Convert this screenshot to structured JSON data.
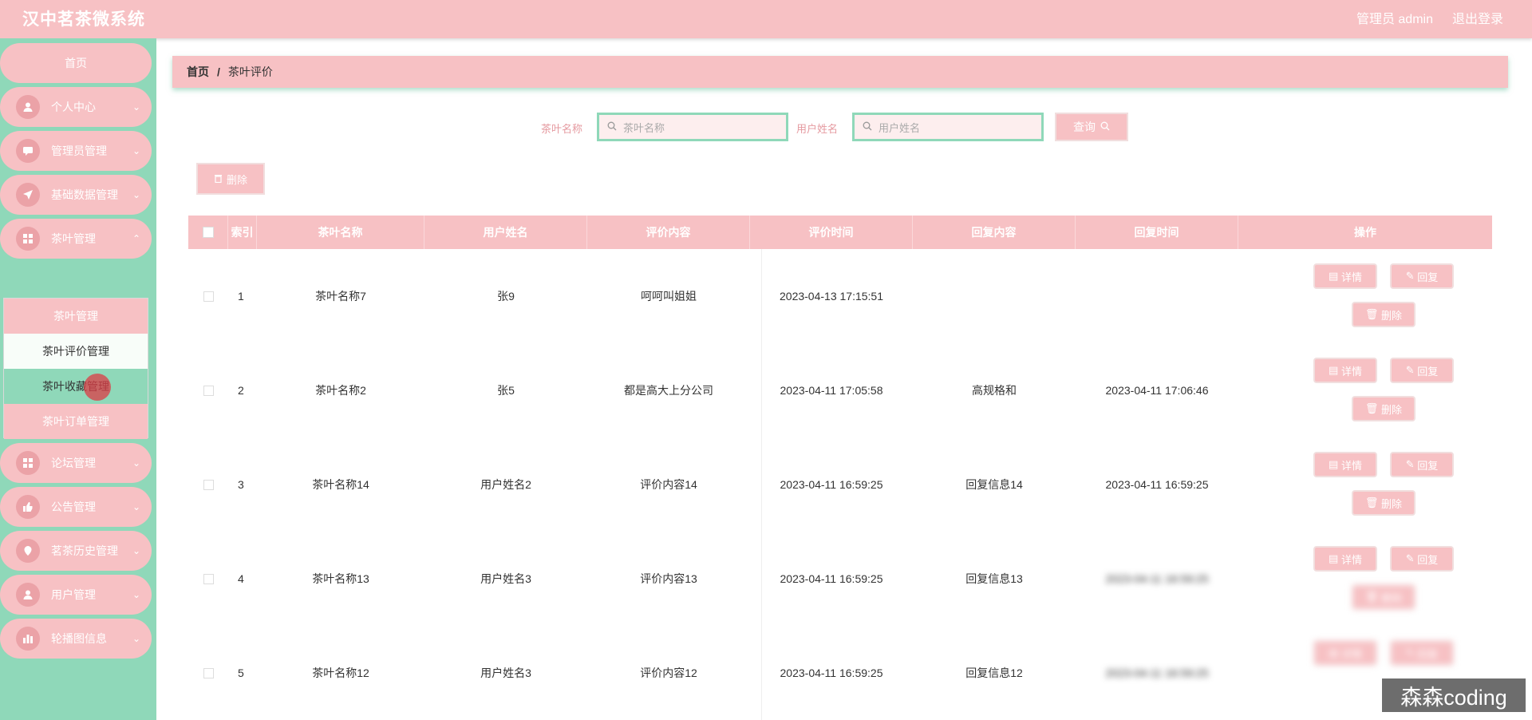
{
  "header": {
    "title": "汉中茗茶微系统",
    "user": "管理员 admin",
    "logout": "退出登录"
  },
  "sidebar": {
    "home": "首页",
    "items": [
      {
        "label": "个人中心",
        "icon": "user-icon"
      },
      {
        "label": "管理员管理",
        "icon": "chat-icon"
      },
      {
        "label": "基础数据管理",
        "icon": "send-icon"
      },
      {
        "label": "茶叶管理",
        "icon": "grid-icon"
      },
      {
        "label": "论坛管理",
        "icon": "grid-icon"
      },
      {
        "label": "公告管理",
        "icon": "thumb-icon"
      },
      {
        "label": "茗茶历史管理",
        "icon": "location-icon"
      },
      {
        "label": "用户管理",
        "icon": "user-icon"
      },
      {
        "label": "轮播图信息",
        "icon": "chart-icon"
      }
    ],
    "submenu": [
      "茶叶管理",
      "茶叶评价管理",
      "茶叶收藏管理",
      "茶叶订单管理"
    ]
  },
  "breadcrumb": {
    "home": "首页",
    "separator": "/",
    "current": "茶叶评价"
  },
  "search": {
    "field1_label": "茶叶名称",
    "field1_placeholder": "茶叶名称",
    "field2_label": "用户姓名",
    "field2_placeholder": "用户姓名",
    "query_button": "查询"
  },
  "toolbar": {
    "delete_button": "删除"
  },
  "table": {
    "headers": [
      "索引",
      "茶叶名称",
      "用户姓名",
      "评价内容",
      "评价时间",
      "回复内容",
      "回复时间",
      "操作"
    ],
    "rows": [
      {
        "index": "1",
        "tea": "茶叶名称7",
        "user": "张9",
        "content": "呵呵叫姐姐",
        "time": "2023-04-13 17:15:51",
        "reply": "",
        "reply_time": ""
      },
      {
        "index": "2",
        "tea": "茶叶名称2",
        "user": "张5",
        "content": "都是高大上分公司",
        "time": "2023-04-11 17:05:58",
        "reply": "高规格和",
        "reply_time": "2023-04-11 17:06:46"
      },
      {
        "index": "3",
        "tea": "茶叶名称14",
        "user": "用户姓名2",
        "content": "评价内容14",
        "time": "2023-04-11 16:59:25",
        "reply": "回复信息14",
        "reply_time": "2023-04-11 16:59:25"
      },
      {
        "index": "4",
        "tea": "茶叶名称13",
        "user": "用户姓名3",
        "content": "评价内容13",
        "time": "2023-04-11 16:59:25",
        "reply": "回复信息13",
        "reply_time": "2023-04-11 16:59:25"
      },
      {
        "index": "5",
        "tea": "茶叶名称12",
        "user": "用户姓名3",
        "content": "评价内容12",
        "time": "2023-04-11 16:59:25",
        "reply": "回复信息12",
        "reply_time": "2023-04-11 16:59:25"
      }
    ],
    "ops": {
      "detail": "详情",
      "reply": "回复",
      "delete": "删除"
    }
  },
  "watermark": "森森coding",
  "colors": {
    "primary_pink": "#f7c1c4",
    "sidebar_green": "#8fd8b9",
    "label_pink": "#e59aa0"
  }
}
